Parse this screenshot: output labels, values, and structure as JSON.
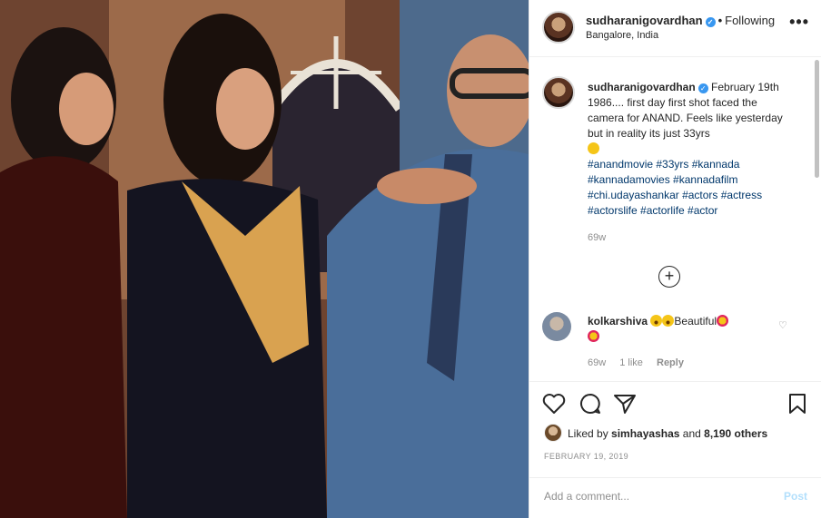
{
  "header": {
    "username": "sudharanigovardhan",
    "follow_status": "Following",
    "separator": "•",
    "location": "Bangalore, India",
    "more": "•••"
  },
  "caption": {
    "username": "sudharanigovardhan",
    "text": "February 19th 1986.... first day first shot faced the camera for ANAND. Feels like yesterday but in reality its just 33yrs",
    "hashtags": "#anandmovie #33yrs #kannada #kannadamovies #kannadafilm #chi.udayashankar #actors #actress #actorslife #actorlife #actor",
    "age": "69w"
  },
  "load_more": "+",
  "comment": {
    "username": "kolkarshiva",
    "text": "Beautiful",
    "age": "69w",
    "likes": "1 like",
    "reply": "Reply"
  },
  "likes": {
    "prefix": "Liked by",
    "user": "simhayashas",
    "joiner": "and",
    "others": "8,190 others"
  },
  "date": "FEBRUARY 19, 2019",
  "add_comment": {
    "placeholder": "Add a comment...",
    "post": "Post"
  },
  "colors": {
    "link": "#00376b",
    "verified": "#3897f0",
    "post_disabled": "#b2dffc",
    "muted": "#8e8e8e"
  },
  "icons": [
    "heart-icon",
    "comment-icon",
    "share-icon",
    "bookmark-icon",
    "verified-icon",
    "more-icon",
    "add-icon"
  ]
}
